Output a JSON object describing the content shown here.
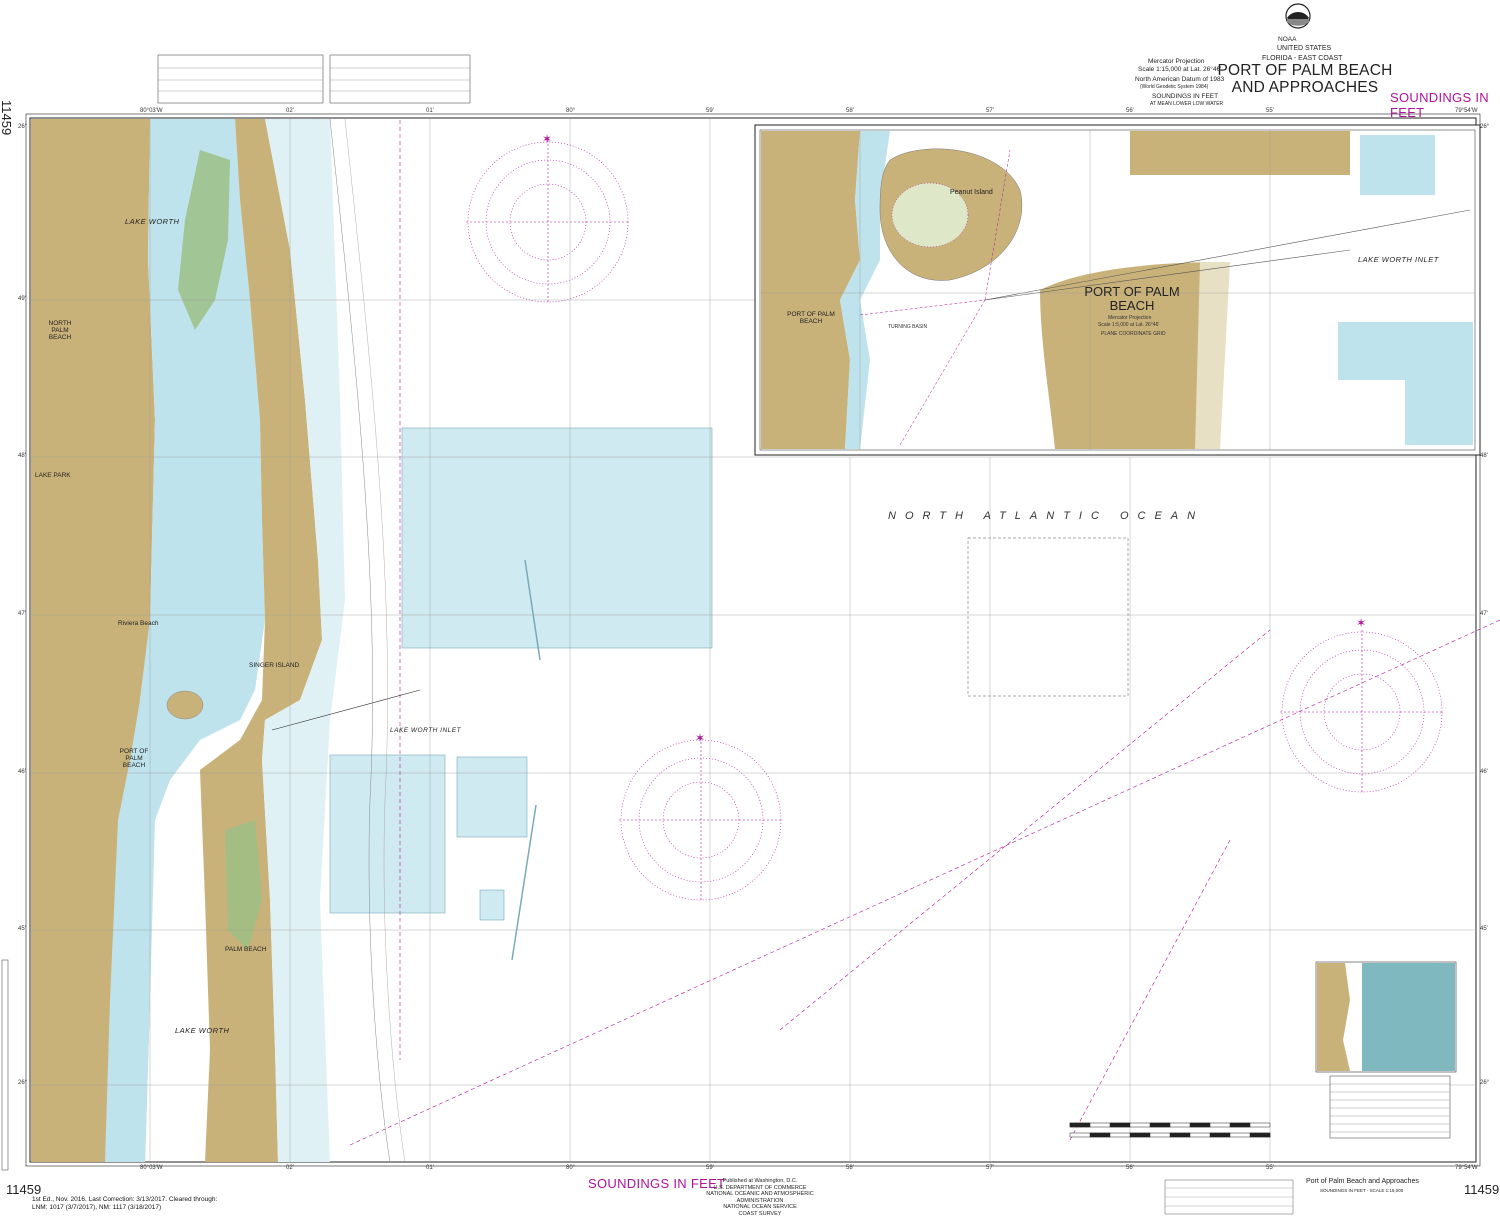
{
  "chart": {
    "number": "11459",
    "region": "FLORIDA - EAST COAST",
    "country": "UNITED STATES",
    "title": "PORT OF PALM BEACH AND APPROACHES",
    "soundings": "SOUNDINGS IN FEET",
    "edition": "1st Ed., Nov. 2016. Last Correction: 3/13/2017. Cleared through:",
    "edition_line2": "LNM: 1017 (3/7/2017), NM: 1117 (3/18/2017)",
    "footer_title": "Port of Palm Beach and Approaches",
    "footer_sub": "SOUNDINGS IN FEET - SCALE 1:15,000"
  },
  "header_block": {
    "projection": "Mercator Projection",
    "scale": "Scale 1:15,000 at Lat. 26°46'",
    "datum": "North American Datum of 1983",
    "datum_sub": "(World Geodetic System 1984)",
    "sounding_note": "SOUNDINGS IN FEET",
    "sounding_sub": "AT MEAN LOWER LOW WATER"
  },
  "publisher": {
    "line1": "Published at Washington, D.C.",
    "line2": "U.S. DEPARTMENT OF COMMERCE",
    "line3": "NATIONAL OCEANIC AND ATMOSPHERIC ADMINISTRATION",
    "line4": "NATIONAL OCEAN SERVICE",
    "line5": "COAST SURVEY"
  },
  "labels": {
    "lake_worth_north": "LAKE WORTH",
    "north_palm_beach": "NORTH PALM BEACH",
    "lake_park": "LAKE PARK",
    "riviera_beach": "Riviera Beach",
    "singer_island": "SINGER ISLAND",
    "port_of_palm_beach": "PORT OF PALM BEACH",
    "lake_worth_inlet": "LAKE WORTH INLET",
    "palm_beach": "PALM BEACH",
    "lake_worth_south": "LAKE WORTH",
    "ocean": "NORTH ATLANTIC OCEAN"
  },
  "inset": {
    "title": "PORT OF PALM BEACH",
    "projection": "Mercator Projection",
    "scale": "Scale 1:5,000 at Lat. 26°46'",
    "grid": "PLANE COORDINATE GRID",
    "peanut_island": "Peanut Island",
    "port_label": "PORT OF PALM BEACH",
    "inlet": "LAKE WORTH INLET",
    "turning_basin": "TURNING BASIN"
  },
  "coords": {
    "lon_80_03": "80°03'W",
    "lon_02": "02'",
    "lon_01": "01'",
    "lon_80": "80°",
    "lon_59": "59'",
    "lon_58": "58'",
    "lon_57": "57'",
    "lon_56": "56'",
    "lon_55": "55'",
    "lon_79_54": "79°54'W",
    "lat_26_50": "26°",
    "lat_49": "49'",
    "lat_48": "48'",
    "lat_47": "47'",
    "lat_46": "46'",
    "lat_45": "45'",
    "lat_26_44": "26°\n44'"
  },
  "colors": {
    "land": "#c9b27a",
    "land_dark": "#b49a5e",
    "shallow": "#bfe3ec",
    "water": "#ffffff",
    "magenta": "#b0139a",
    "green": "#9bbf86"
  }
}
